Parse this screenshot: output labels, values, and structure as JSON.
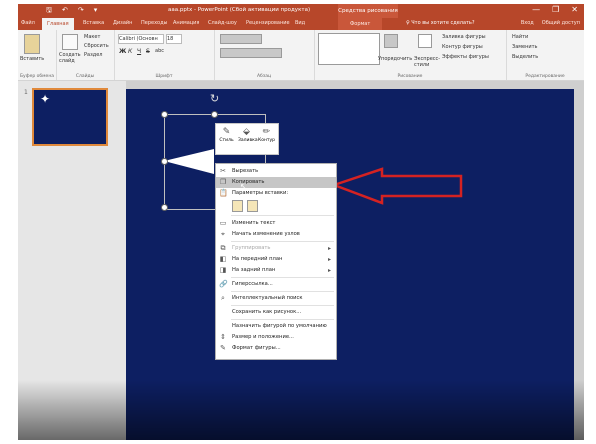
{
  "window": {
    "title": "ааа.pptx - PowerPoint (Сбой активации продукта)",
    "context_tab_group": "Средства рисования",
    "minimize": "—",
    "restore": "❐",
    "close": "✕"
  },
  "quick_access": {
    "save": "🖫",
    "undo": "↶",
    "redo": "↷",
    "more": "▾"
  },
  "tabs": [
    {
      "label": "Файл"
    },
    {
      "label": "Главная"
    },
    {
      "label": "Вставка"
    },
    {
      "label": "Дизайн"
    },
    {
      "label": "Переходы"
    },
    {
      "label": "Анимация"
    },
    {
      "label": "Слайд-шоу"
    },
    {
      "label": "Рецензирование"
    },
    {
      "label": "Вид"
    },
    {
      "label": "Формат"
    }
  ],
  "tell_me": "♀ Что вы хотите сделать?",
  "account": {
    "signin": "Вход",
    "share": "Общий доступ"
  },
  "ribbon": {
    "clipboard": {
      "paste": "Вставить",
      "label": "Буфер обмена"
    },
    "slides": {
      "new_slide": "Создать слайд",
      "layout": "Макет",
      "reset": "Сбросить",
      "section": "Раздел",
      "label": "Слайды"
    },
    "font": {
      "name": "Calibri (Основн",
      "size": "18",
      "bold": "Ж",
      "italic": "К",
      "underline": "Ч",
      "strike": "S",
      "shadow": "abc",
      "label": "Шрифт"
    },
    "paragraph": {
      "label": "Абзац"
    },
    "drawing": {
      "arrange": "Упорядочить",
      "quick_styles": "Экспресс-стили",
      "fill": "Заливка фигуры",
      "outline": "Контур фигуры",
      "effects": "Эффекты фигуры",
      "label": "Рисование"
    },
    "editing": {
      "find": "Найти",
      "replace": "Заменить",
      "select": "Выделить",
      "label": "Редактирование"
    }
  },
  "thumbnails": [
    {
      "number": "1",
      "star": "✦"
    }
  ],
  "mini_toolbar": [
    {
      "icon": "✎",
      "label": "Стиль"
    },
    {
      "icon": "⬙",
      "label": "Заливка"
    },
    {
      "icon": "✏",
      "label": "Контур"
    }
  ],
  "context_menu": {
    "cut": "Вырезать",
    "copy": "Копировать",
    "paste_options": "Параметры вставки:",
    "edit_text": "Изменить текст",
    "edit_points": "Начать изменение узлов",
    "group": "Группировать",
    "bring_forward": "На передний план",
    "send_backward": "На задний план",
    "hyperlink": "Гиперссылка...",
    "smart_lookup": "Интеллектуальный поиск",
    "save_as_picture": "Сохранить как рисунок...",
    "set_default": "Назначить фигурой по умолчанию",
    "size_position": "Размер и положение...",
    "format_shape": "Формат фигуры..."
  },
  "colors": {
    "ribbon_accent": "#b7472a",
    "slide_background": "#0d1f62",
    "annotation_arrow": "#d42222",
    "thumbnail_selection": "#e0893b"
  }
}
